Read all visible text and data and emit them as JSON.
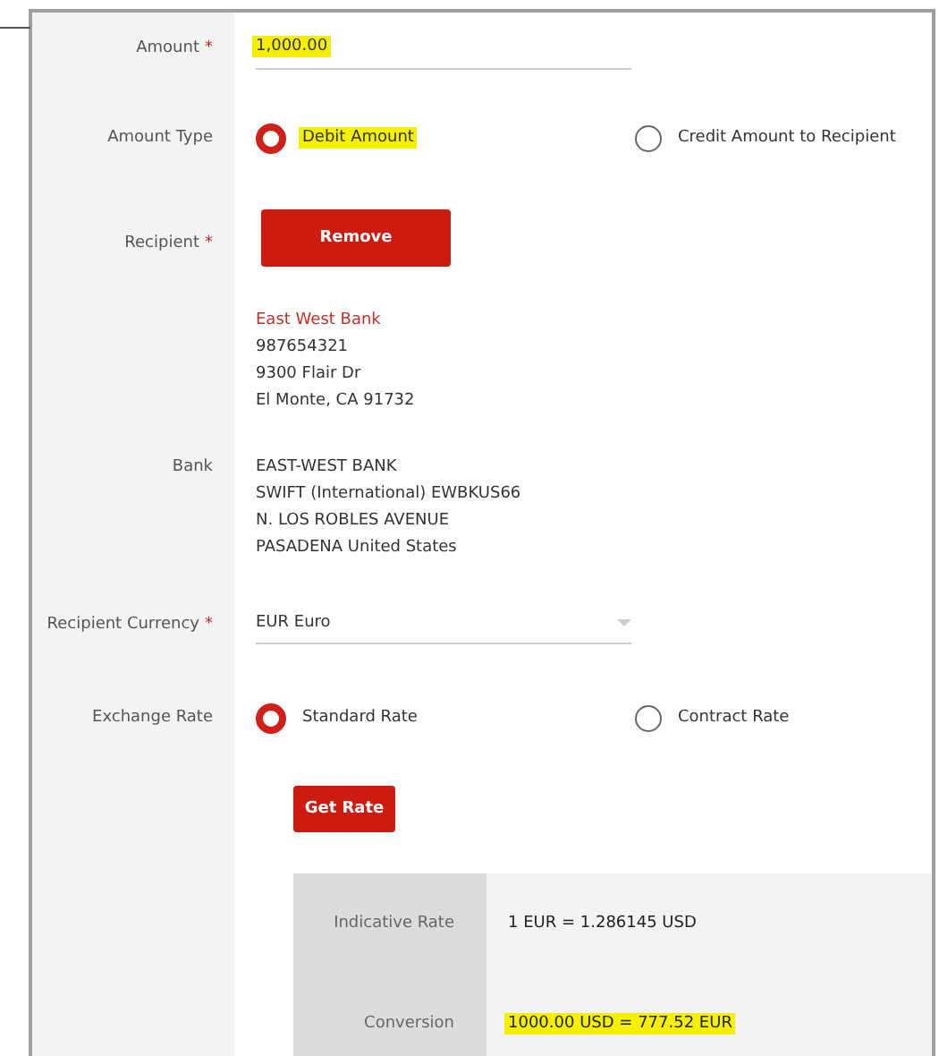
{
  "fields": [
    {
      "kind": "text",
      "label": "Amount",
      "required_mark": "*",
      "value": "1,000.00",
      "highlighted": true
    },
    {
      "kind": "radio",
      "label": "Amount Type",
      "options": [
        {
          "label": "Debit Amount",
          "selected": true,
          "highlighted": true
        },
        {
          "label": "Credit Amount to Recipient",
          "selected": false,
          "highlighted": false
        }
      ]
    },
    {
      "kind": "recipient",
      "label": "Recipient",
      "required_mark": "*",
      "button": "Remove",
      "name": "East West Bank",
      "lines": [
        "987654321",
        "9300 Flair Dr",
        "El Monte, CA 91732"
      ]
    },
    {
      "kind": "info",
      "label": "Bank",
      "lines": [
        "EAST-WEST BANK",
        "SWIFT (International) EWBKUS66",
        "N. LOS ROBLES AVENUE",
        "PASADENA United States"
      ]
    },
    {
      "kind": "select",
      "label": "Recipient Currency",
      "required_mark": "*",
      "value": "EUR Euro"
    },
    {
      "kind": "radio",
      "label": "Exchange Rate",
      "options": [
        {
          "label": "Standard Rate",
          "selected": true,
          "highlighted": false
        },
        {
          "label": "Contract Rate",
          "selected": false,
          "highlighted": false
        }
      ]
    }
  ],
  "get_rate_button": "Get Rate",
  "rate_table": [
    {
      "label": "Indicative Rate",
      "value": "1 EUR = 1.286145 USD",
      "highlighted": false
    },
    {
      "label": "Conversion",
      "value": "1000.00 USD = 777.52 EUR",
      "highlighted": true
    }
  ]
}
